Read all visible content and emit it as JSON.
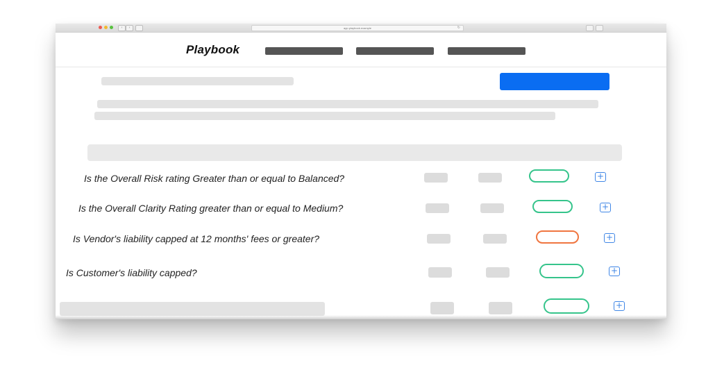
{
  "browser": {
    "url": "app.playbook.example"
  },
  "header": {
    "brand": "Playbook"
  },
  "colors": {
    "primary_button": "#0a6df2",
    "status_ok": "#35c48b",
    "status_warn": "#f0753f",
    "add_icon": "#3f86e6"
  },
  "rows": [
    {
      "question": "Is the Overall Risk rating Greater than or equal to Balanced?",
      "status": "ok"
    },
    {
      "question": "Is the Overall Clarity Rating greater than or equal to Medium?",
      "status": "ok"
    },
    {
      "question": "Is Vendor's liability capped at 12 months' fees or greater?",
      "status": "warn"
    },
    {
      "question": "Is Customer's liability capped?",
      "status": "ok"
    },
    {
      "question": "",
      "status": "ok"
    }
  ],
  "icons": {
    "add": "plus-icon",
    "back": "chevron-left-icon",
    "forward": "chevron-right-icon",
    "reload": "reload-icon"
  }
}
